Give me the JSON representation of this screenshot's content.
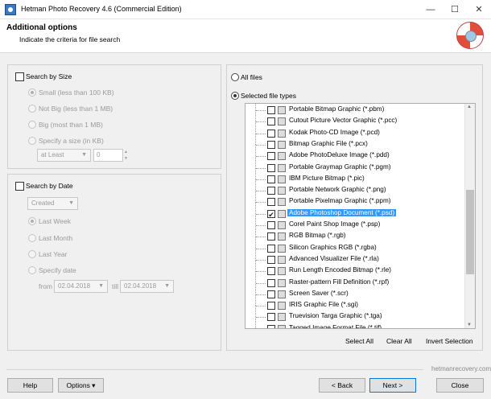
{
  "window": {
    "title": "Hetman Photo Recovery 4.6 (Commercial Edition)",
    "controls": [
      "—",
      "☐",
      "✕"
    ]
  },
  "header": {
    "title": "Additional options",
    "subtitle": "Indicate the criteria for file search"
  },
  "size": {
    "label": "Search by Size",
    "checked": false,
    "options": [
      "Small (less than 100 KB)",
      "Not Big (less than 1 MB)",
      "Big (most than 1 MB)",
      "Specify a size (in KB)"
    ],
    "selected_index": 0,
    "mode": "at Least",
    "value": "0"
  },
  "date": {
    "label": "Search by Date",
    "checked": false,
    "criteria": "Created",
    "options": [
      "Last Week",
      "Last Month",
      "Last Year",
      "Specify date"
    ],
    "selected_index": 0,
    "from_label": "from",
    "from": "02.04.2018",
    "till_label": "till",
    "till": "02.04.2018"
  },
  "types": {
    "all_files": "All files",
    "selected_types": "Selected file types",
    "mode": "selected",
    "items": [
      {
        "name": "Portable Bitmap Graphic (*.pbm)",
        "checked": false
      },
      {
        "name": "Cutout Picture Vector Graphic (*.pcc)",
        "checked": false
      },
      {
        "name": "Kodak Photo-CD Image (*.pcd)",
        "checked": false
      },
      {
        "name": "Bitmap Graphic File (*.pcx)",
        "checked": false
      },
      {
        "name": "Adobe PhotoDeluxe Image (*.pdd)",
        "checked": false
      },
      {
        "name": "Portable Graymap Graphic (*.pgm)",
        "checked": false
      },
      {
        "name": "IBM Picture Bitmap (*.pic)",
        "checked": false
      },
      {
        "name": "Portable Network Graphic (*.png)",
        "checked": false
      },
      {
        "name": "Portable Pixelmap Graphic (*.ppm)",
        "checked": false
      },
      {
        "name": "Adobe Photoshop Document (*.psd)",
        "checked": true,
        "selected": true
      },
      {
        "name": "Corel Paint Shop Image (*.psp)",
        "checked": false
      },
      {
        "name": "RGB Bitmap (*.rgb)",
        "checked": false
      },
      {
        "name": "Silicon Graphics RGB (*.rgba)",
        "checked": false
      },
      {
        "name": "Advanced Visualizer File (*.rla)",
        "checked": false
      },
      {
        "name": "Run Length Encoded Bitmap (*.rle)",
        "checked": false
      },
      {
        "name": "Raster-pattern Fill Definition (*.rpf)",
        "checked": false
      },
      {
        "name": "Screen Saver (*.scr)",
        "checked": false
      },
      {
        "name": "IRIS Graphic File (*.sgi)",
        "checked": false
      },
      {
        "name": "Truevision Targa Graphic (*.tga)",
        "checked": false
      },
      {
        "name": "Tagged Image Format File (*.tif)",
        "checked": false
      }
    ],
    "select_all": "Select All",
    "clear_all": "Clear All",
    "invert": "Invert Selection"
  },
  "footer": {
    "brand": "hetmanrecovery.com",
    "help": "Help",
    "options": "Options ▾",
    "back": "< Back",
    "next": "Next >",
    "close": "Close"
  },
  "colors": {
    "selection": "#3399ff",
    "default_button_border": "#0078d7"
  }
}
